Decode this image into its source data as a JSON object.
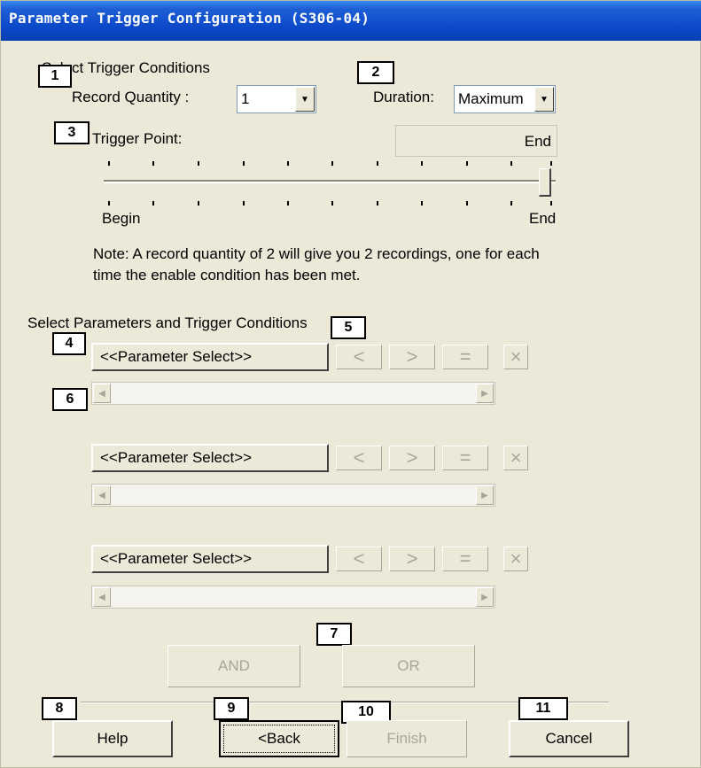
{
  "window": {
    "title": "Parameter Trigger Configuration (S306-04)"
  },
  "markers": [
    "1",
    "2",
    "3",
    "4",
    "5",
    "6",
    "7",
    "8",
    "9",
    "10",
    "11"
  ],
  "trigger_conditions": {
    "group_label": "Select Trigger Conditions",
    "record_quantity_label": "Record Quantity :",
    "record_quantity_value": "1",
    "duration_label": "Duration:",
    "duration_value": "Maximum"
  },
  "trigger_point": {
    "label": "Trigger Point:",
    "readout": "End",
    "begin_label": "Begin",
    "end_label": "End",
    "slider_level": 1.0
  },
  "note": {
    "line1": "Note: A record quantity of 2 will give you 2 recordings, one for each",
    "line2": "time the enable condition has been met."
  },
  "parameters": {
    "group_label": "Select Parameters and Trigger Conditions",
    "rows": [
      {
        "select_label": "<<Parameter Select>>",
        "lt": "<",
        "gt": ">",
        "eq": "=",
        "del": "×"
      },
      {
        "select_label": "<<Parameter Select>>",
        "lt": "<",
        "gt": ">",
        "eq": "=",
        "del": "×"
      },
      {
        "select_label": "<<Parameter Select>>",
        "lt": "<",
        "gt": ">",
        "eq": "=",
        "del": "×"
      }
    ],
    "scroll_left": "◀",
    "scroll_right": "▶"
  },
  "logic": {
    "and_label": "AND",
    "or_label": "OR"
  },
  "footer": {
    "help_label": "Help",
    "back_label": "<Back",
    "finish_label": "Finish",
    "cancel_label": "Cancel"
  }
}
